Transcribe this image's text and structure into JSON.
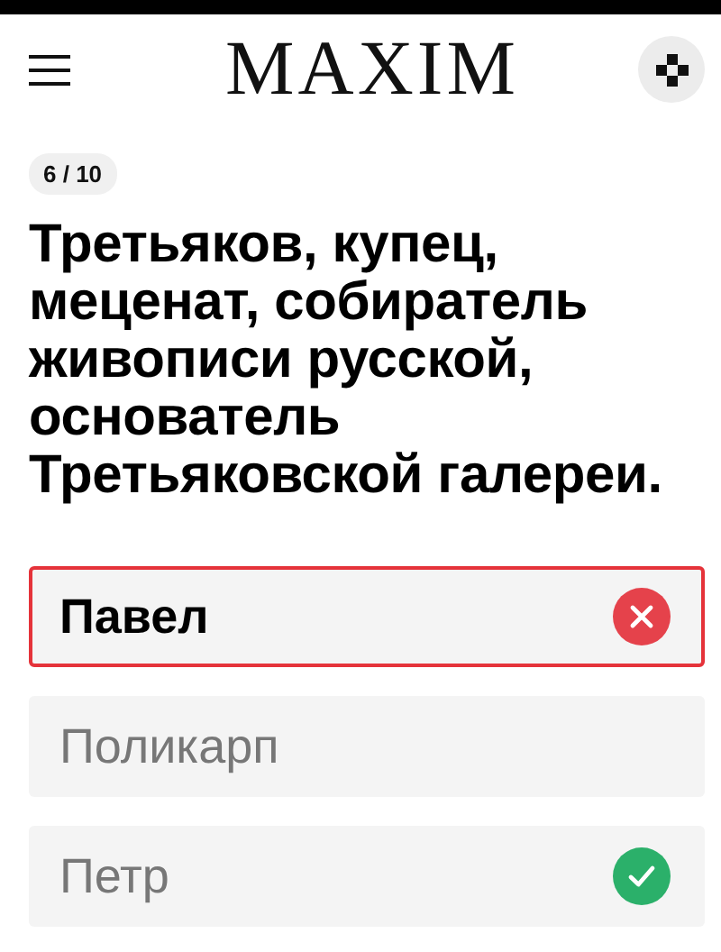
{
  "header": {
    "logo": "MAXIM"
  },
  "progress": "6 / 10",
  "question": "Третьяков, купец, меценат, собиратель живописи русской, основатель Третьяковской галереи.",
  "options": [
    {
      "label": "Павел",
      "selected": true,
      "kind": "wrong"
    },
    {
      "label": "Поликарп",
      "selected": false,
      "kind": "plain"
    },
    {
      "label": "Петр",
      "selected": false,
      "kind": "correct"
    }
  ]
}
